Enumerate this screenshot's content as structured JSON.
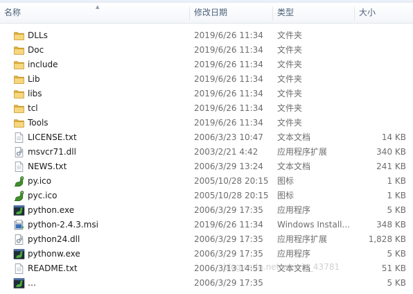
{
  "columns": {
    "name": "名称",
    "date": "修改日期",
    "type": "类型",
    "size": "大小"
  },
  "rows": [
    {
      "name": "DLLs",
      "date": "2019/6/26 11:34",
      "type": "文件夹",
      "size": "",
      "icon": "folder-icon"
    },
    {
      "name": "Doc",
      "date": "2019/6/26 11:34",
      "type": "文件夹",
      "size": "",
      "icon": "folder-icon"
    },
    {
      "name": "include",
      "date": "2019/6/26 11:34",
      "type": "文件夹",
      "size": "",
      "icon": "folder-icon"
    },
    {
      "name": "Lib",
      "date": "2019/6/26 11:34",
      "type": "文件夹",
      "size": "",
      "icon": "folder-icon"
    },
    {
      "name": "libs",
      "date": "2019/6/26 11:34",
      "type": "文件夹",
      "size": "",
      "icon": "folder-icon"
    },
    {
      "name": "tcl",
      "date": "2019/6/26 11:34",
      "type": "文件夹",
      "size": "",
      "icon": "folder-icon"
    },
    {
      "name": "Tools",
      "date": "2019/6/26 11:34",
      "type": "文件夹",
      "size": "",
      "icon": "folder-icon"
    },
    {
      "name": "LICENSE.txt",
      "date": "2006/3/23 10:47",
      "type": "文本文档",
      "size": "14 KB",
      "icon": "text-file-icon"
    },
    {
      "name": "msvcr71.dll",
      "date": "2003/2/21 4:42",
      "type": "应用程序扩展",
      "size": "340 KB",
      "icon": "dll-file-icon"
    },
    {
      "name": "NEWS.txt",
      "date": "2006/3/29 13:24",
      "type": "文本文档",
      "size": "241 KB",
      "icon": "text-file-icon"
    },
    {
      "name": "py.ico",
      "date": "2005/10/28 20:15",
      "type": "图标",
      "size": "1 KB",
      "icon": "python-icon"
    },
    {
      "name": "pyc.ico",
      "date": "2005/10/28 20:15",
      "type": "图标",
      "size": "1 KB",
      "icon": "python-icon"
    },
    {
      "name": "python.exe",
      "date": "2006/3/29 17:35",
      "type": "应用程序",
      "size": "5 KB",
      "icon": "python-exe-icon"
    },
    {
      "name": "python-2.4.3.msi",
      "date": "2019/6/26 11:34",
      "type": "Windows Install...",
      "size": "348 KB",
      "icon": "installer-icon"
    },
    {
      "name": "python24.dll",
      "date": "2006/3/29 17:35",
      "type": "应用程序扩展",
      "size": "1,828 KB",
      "icon": "dll-file-icon"
    },
    {
      "name": "pythonw.exe",
      "date": "2006/3/29 17:35",
      "type": "应用程序",
      "size": "5 KB",
      "icon": "python-exe-icon"
    },
    {
      "name": "README.txt",
      "date": "2006/3/13 14:51",
      "type": "文本文档",
      "size": "51 KB",
      "icon": "text-file-icon"
    },
    {
      "name": "…",
      "date": "2006/3/29 17:35",
      "type": "",
      "size": "5 KB",
      "icon": "python-exe-icon"
    }
  ],
  "watermark": "blog.csdn.net/weixin_43781"
}
